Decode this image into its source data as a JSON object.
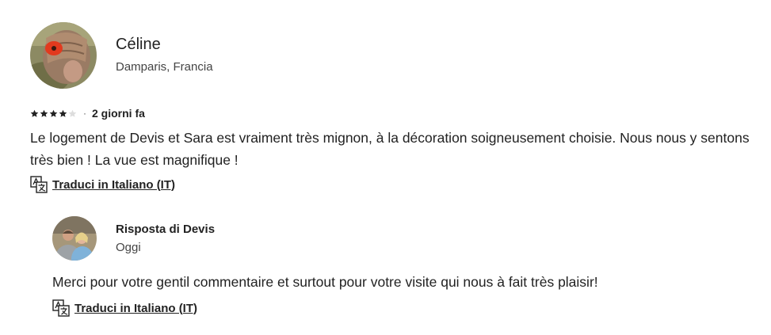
{
  "review": {
    "author_name": "Céline",
    "author_location": "Damparis, Francia",
    "rating": 4,
    "rating_max": 5,
    "date": "2 giorni fa",
    "text": "Le logement de Devis et Sara est vraiment très mignon, à la décoration soigneusement choisie. Nous nous y sentons très bien ! La vue est magnifique !",
    "translate_label": "Traduci in Italiano (IT)"
  },
  "response": {
    "title": "Risposta di Devis",
    "date": "Oggi",
    "text": "Merci pour votre gentil commentaire et surtout pour votre visite qui nous à fait très plaisir!",
    "translate_label": "Traduci in Italiano (IT)"
  },
  "icons": {
    "star": "star-icon",
    "translate": "translate-icon"
  },
  "colors": {
    "text": "#222222",
    "star_filled": "#222222",
    "star_empty": "#dddddd"
  }
}
